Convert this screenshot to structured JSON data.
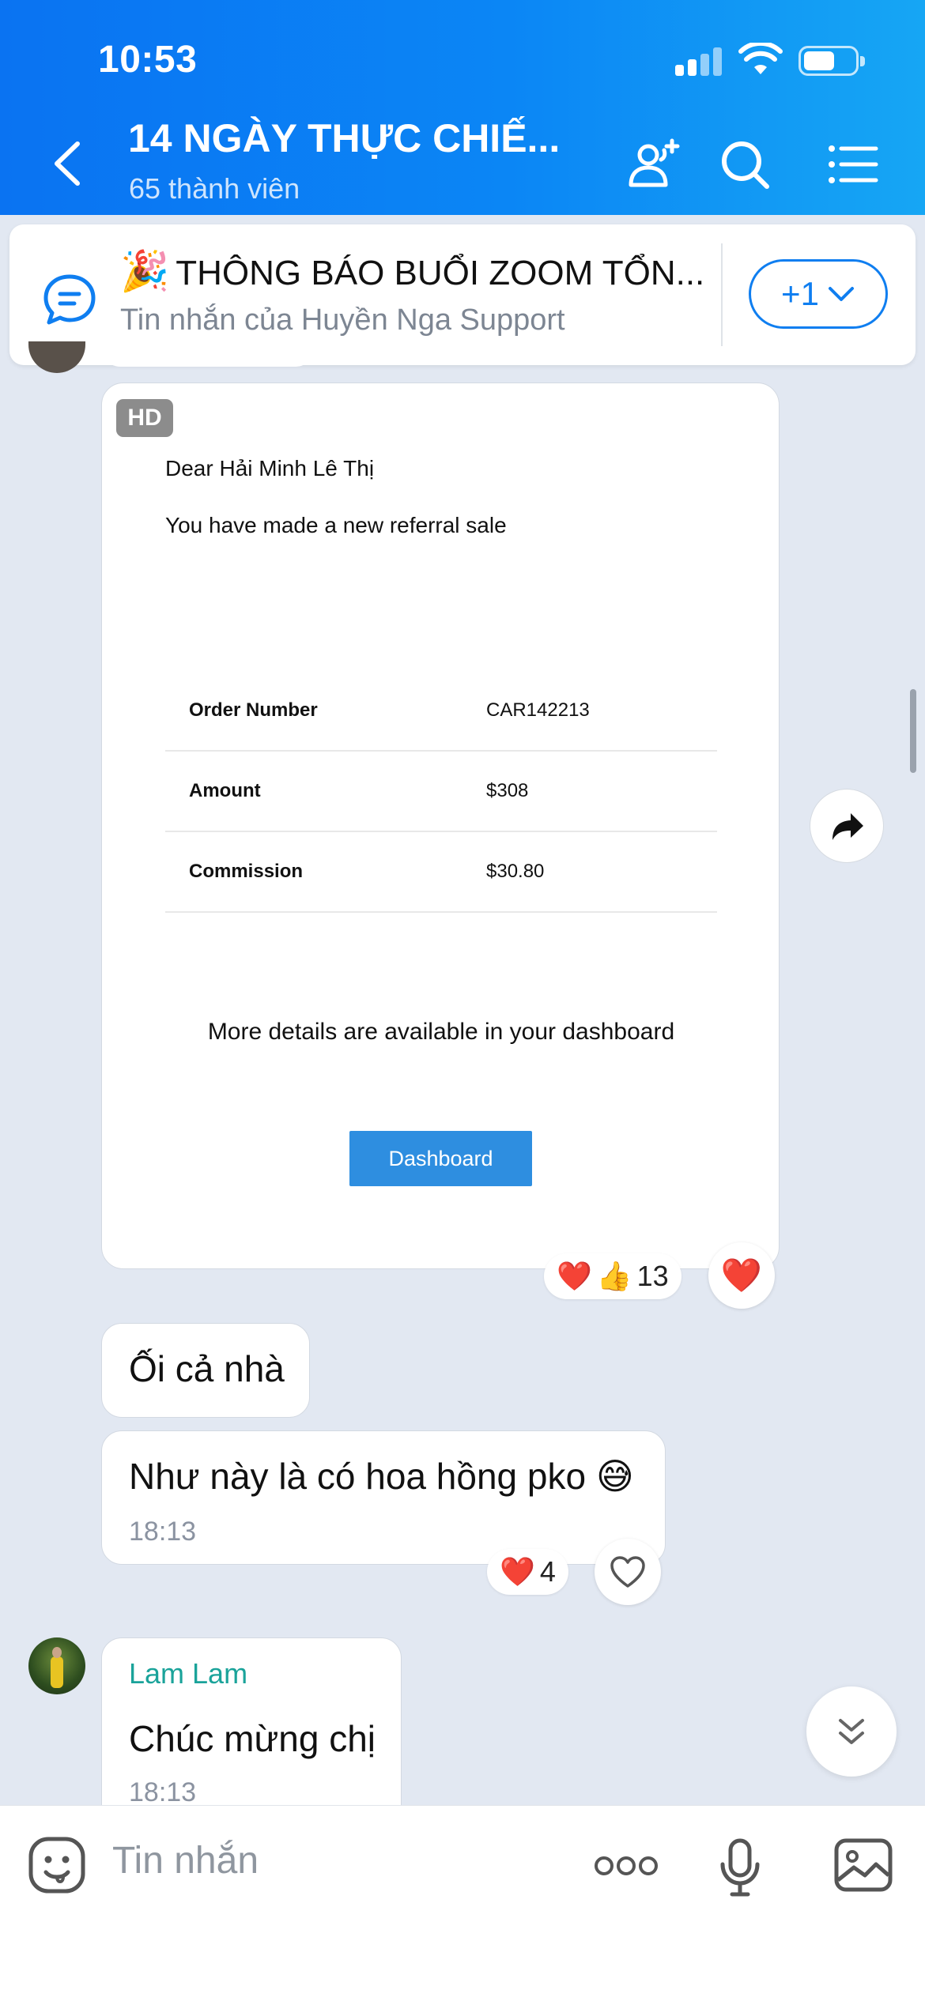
{
  "status": {
    "time": "10:53"
  },
  "header": {
    "title": "14 NGÀY THỰC CHIẾ...",
    "subtitle": "65 thành viên"
  },
  "pinned": {
    "title": "THÔNG BÁO BUỔI ZOOM TỔN...",
    "subtitle": "Tin nhắn của Huyền Nga Support",
    "count": "+1"
  },
  "card": {
    "badge": "HD",
    "greeting": "Dear Hải Minh Lê Thị",
    "intro": "You have made a new referral sale",
    "rows": [
      {
        "key": "Order Number",
        "value": "CAR142213"
      },
      {
        "key": "Amount",
        "value": "$308"
      },
      {
        "key": "Commission",
        "value": "$30.80"
      }
    ],
    "more": "More details are available in your dashboard",
    "button": "Dashboard",
    "reaction_count": "13"
  },
  "messages": [
    {
      "text": "Ối cả nhà"
    },
    {
      "text": "Như này là có hoa hồng pko 😅",
      "time": "18:13",
      "reaction_count": "4"
    },
    {
      "sender": "Lam Lam",
      "text": "Chúc mừng chị",
      "time": "18:13"
    }
  ],
  "input": {
    "placeholder": "Tin nhắn"
  },
  "colors": {
    "header_start": "#0a73f2",
    "header_end": "#16a6f4",
    "accent": "#0f7ef0",
    "sender": "#1aa39a",
    "chat_bg": "#e2e8f2"
  }
}
